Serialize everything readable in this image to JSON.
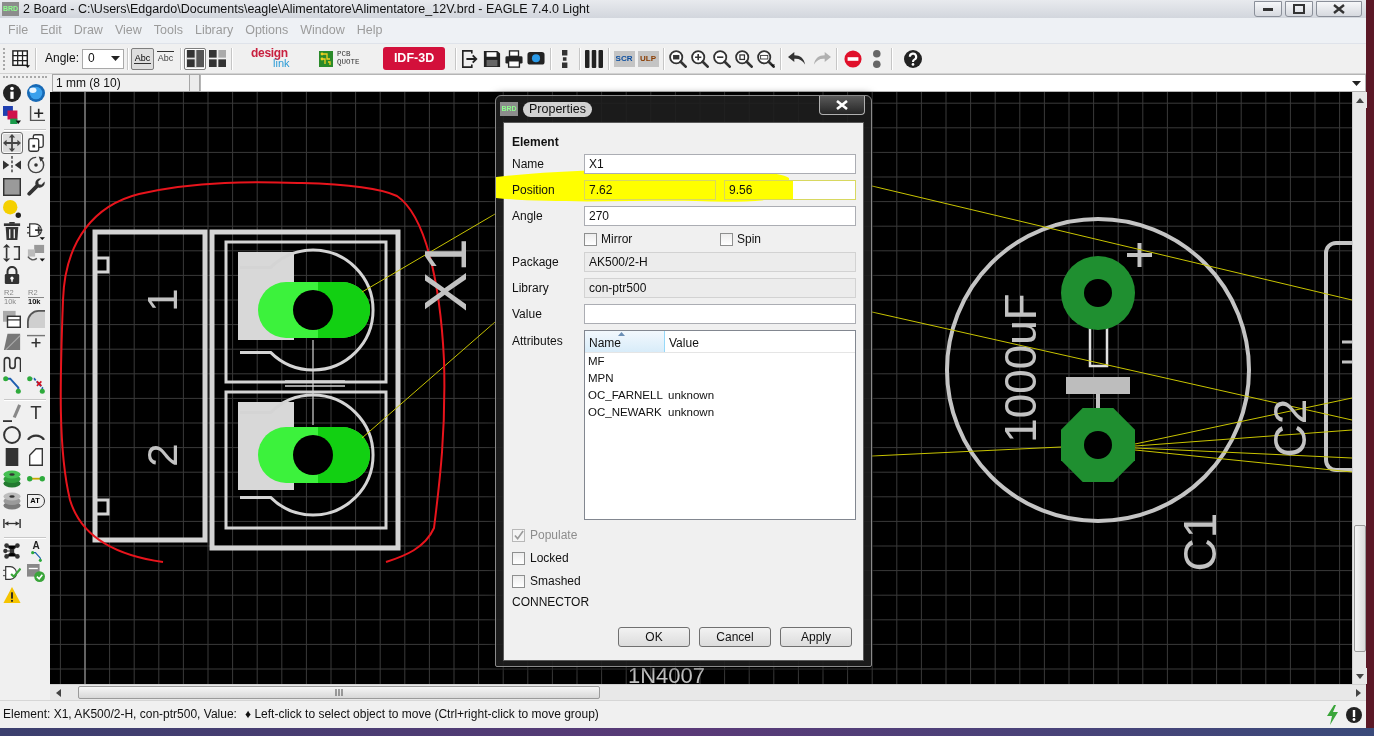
{
  "window": {
    "icon_text": "BRD",
    "title": "2 Board - C:\\Users\\Edgardo\\Documents\\eagle\\Alimentatore\\Alimentatore_12V.brd - EAGLE 7.4.0 Light"
  },
  "menu": [
    {
      "label": "File",
      "disabled": true
    },
    {
      "label": "Edit",
      "disabled": true
    },
    {
      "label": "Draw",
      "disabled": true
    },
    {
      "label": "View",
      "disabled": true
    },
    {
      "label": "Tools",
      "disabled": true
    },
    {
      "label": "Library",
      "disabled": true
    },
    {
      "label": "Options",
      "disabled": true
    },
    {
      "label": "Window",
      "disabled": true
    },
    {
      "label": "Help",
      "disabled": true
    }
  ],
  "toolbar": {
    "angle_label": "Angle:",
    "angle_value": "0",
    "text_modes": [
      {
        "label": "Abc",
        "selected": true
      },
      {
        "label": "Abc",
        "selected": false
      }
    ],
    "layouts": [
      {
        "selected": true
      },
      {
        "selected": false
      }
    ],
    "design_link": [
      "design",
      "link"
    ],
    "pcb_quote": [
      "PCB",
      "QUOTE"
    ],
    "idf_button": "IDF-3D",
    "script_button": "SCR",
    "ulp_button": "ULP"
  },
  "coordinates": {
    "readout": "1 mm (8 10)"
  },
  "palette": [
    [
      [
        {
          "kind": "info",
          "selected": false
        },
        {
          "kind": "eye",
          "selected": false
        }
      ],
      [
        {
          "kind": "layers",
          "selected": false
        },
        {
          "kind": "mark",
          "selected": false
        }
      ]
    ],
    [
      [
        {
          "kind": "move",
          "selected": true
        },
        {
          "kind": "copy",
          "selected": false
        }
      ],
      [
        {
          "kind": "mirror",
          "selected": false
        },
        {
          "kind": "rotate",
          "selected": false
        }
      ],
      [
        {
          "kind": "group",
          "selected": false
        },
        {
          "kind": "wrench",
          "selected": false
        }
      ],
      [
        {
          "kind": "paste",
          "selected": false
        }
      ],
      [
        {
          "kind": "trash",
          "selected": false
        },
        {
          "kind": "add",
          "selected": false
        }
      ],
      [
        {
          "kind": "replace",
          "selected": false
        },
        {
          "kind": "swap",
          "selected": false
        }
      ],
      [
        {
          "kind": "lock",
          "selected": false
        }
      ],
      [
        {
          "kind": "name",
          "lines": [
            "R2",
            "10k"
          ],
          "selected": false
        },
        {
          "kind": "value",
          "lines": [
            "R2",
            "10k"
          ],
          "selected": false
        }
      ],
      [
        {
          "kind": "smash",
          "selected": false
        },
        {
          "kind": "miter",
          "selected": false
        }
      ],
      [
        {
          "kind": "split",
          "selected": false
        },
        {
          "kind": "optimize",
          "selected": false
        }
      ],
      [
        {
          "kind": "meander",
          "selected": false
        }
      ],
      [
        {
          "kind": "route",
          "selected": false
        },
        {
          "kind": "ripup",
          "selected": false
        }
      ]
    ],
    [
      [
        {
          "kind": "wire",
          "selected": false
        },
        {
          "kind": "text",
          "label": "T",
          "selected": false
        }
      ],
      [
        {
          "kind": "circle",
          "selected": false
        },
        {
          "kind": "arc",
          "selected": false
        }
      ],
      [
        {
          "kind": "rect",
          "selected": false
        },
        {
          "kind": "polygon",
          "selected": false
        }
      ],
      [
        {
          "kind": "via",
          "selected": false
        },
        {
          "kind": "signal",
          "selected": false
        }
      ],
      [
        {
          "kind": "hole",
          "selected": false
        },
        {
          "kind": "attribute",
          "label": "AT",
          "selected": false
        }
      ],
      [
        {
          "kind": "dimension",
          "selected": false
        }
      ]
    ],
    [
      [
        {
          "kind": "ratsnest",
          "selected": false
        },
        {
          "kind": "autoroute",
          "label": "A",
          "selected": false
        }
      ],
      [
        {
          "kind": "erc",
          "selected": false
        },
        {
          "kind": "drc",
          "selected": false
        }
      ],
      [
        {
          "kind": "warning",
          "selected": false
        }
      ]
    ]
  ],
  "board": {
    "labels": [
      "1",
      "2",
      "X1",
      "1000uF",
      "C1",
      "C2",
      "1N4007"
    ]
  },
  "dialog": {
    "icon_text": "BRD",
    "title": "Properties",
    "section": "Element",
    "rows": [
      {
        "kind": "text",
        "label": "Name",
        "values": [
          "X1"
        ],
        "readonly": false
      },
      {
        "kind": "text",
        "label": "Position",
        "values": [
          "7.62",
          "9.56"
        ],
        "readonly": false
      },
      {
        "kind": "text",
        "label": "Angle",
        "values": [
          "270"
        ],
        "readonly": false
      },
      {
        "kind": "checks",
        "items": [
          {
            "label": "Mirror",
            "checked": false
          },
          {
            "label": "Spin",
            "checked": false
          }
        ]
      },
      {
        "kind": "text",
        "label": "Package",
        "values": [
          "AK500/2-H"
        ],
        "readonly": true
      },
      {
        "kind": "text",
        "label": "Library",
        "values": [
          "con-ptr500"
        ],
        "readonly": true
      },
      {
        "kind": "text",
        "label": "Value",
        "readonly": false
      },
      {
        "kind": "table",
        "label": "Attributes",
        "columns": [
          {
            "label": "Name",
            "sorted": true
          },
          {
            "label": "Value",
            "sorted": false
          }
        ],
        "rows": [
          {
            "name": "MF"
          },
          {
            "name": "MPN"
          },
          {
            "name": "OC_FARNELL",
            "value": "unknown"
          },
          {
            "name": "OC_NEWARK",
            "value": "unknown"
          }
        ]
      }
    ],
    "options": [
      {
        "label": "Populate",
        "checked": true,
        "disabled": true
      },
      {
        "label": "Locked",
        "checked": false,
        "disabled": false
      },
      {
        "label": "Smashed",
        "checked": false,
        "disabled": false
      }
    ],
    "category": "CONNECTOR",
    "buttons": [
      "OK",
      "Cancel",
      "Apply"
    ]
  },
  "status_bar": {
    "info": "Element: X1, AK500/2-H, con-ptr500, Value:",
    "hint": "♦ Left-click to select object to move (Ctrl+right-click to move group)"
  }
}
